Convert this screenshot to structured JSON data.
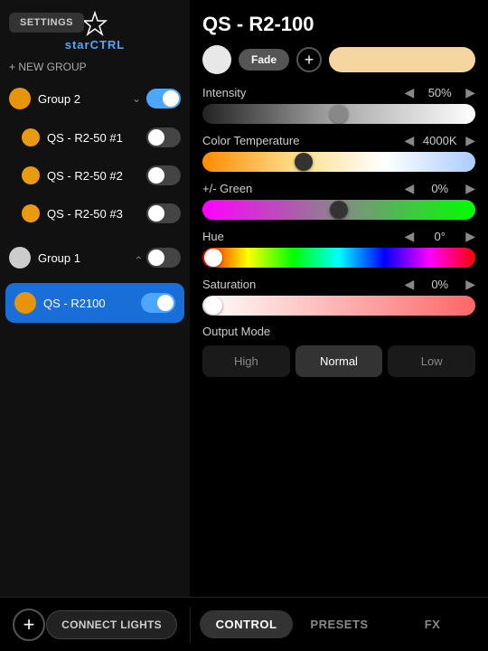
{
  "settings": {
    "button_label": "SETTINGS"
  },
  "logo": {
    "star": "✦",
    "text_prefix": "star",
    "text_suffix": "CTRL"
  },
  "left_panel": {
    "new_group_label": "+ NEW GROUP",
    "groups": [
      {
        "name": "Group 2",
        "color": "#e8940a",
        "expanded": true,
        "toggle": true,
        "children": [
          {
            "name": "QS - R2-50 #1",
            "color": "#e89a10",
            "toggle": false
          },
          {
            "name": "QS - R2-50 #2",
            "color": "#e89a10",
            "toggle": false
          },
          {
            "name": "QS - R2-50 #3",
            "color": "#e89a10",
            "toggle": false
          }
        ]
      },
      {
        "name": "Group 1",
        "color": "#ccc",
        "expanded": false,
        "toggle": false,
        "children": []
      },
      {
        "name": "QS - R2100",
        "color": "#e8940a",
        "expanded": false,
        "toggle": true,
        "selected": true,
        "children": []
      }
    ]
  },
  "right_panel": {
    "device_title": "QS - R2-100",
    "color_preview_bg": "#f5d5a0",
    "fade_label": "Fade",
    "sliders": {
      "intensity": {
        "label": "Intensity",
        "value": "50%",
        "thumb_pct": 50
      },
      "color_temp": {
        "label": "Color Temperature",
        "value": "4000K",
        "thumb_pct": 37
      },
      "green": {
        "label": "+/- Green",
        "value": "0%",
        "thumb_pct": 50
      },
      "hue": {
        "label": "Hue",
        "value": "0°",
        "thumb_pct": 0
      },
      "saturation": {
        "label": "Saturation",
        "value": "0%",
        "thumb_pct": 0
      }
    },
    "output_mode": {
      "label": "Output Mode",
      "buttons": [
        "High",
        "Normal",
        "Low"
      ],
      "active": "Normal"
    }
  },
  "bottom_bar": {
    "connect_lights_label": "CONNECT LIGHTS",
    "tabs": [
      {
        "label": "CONTROL",
        "active": true
      },
      {
        "label": "PRESETS",
        "active": false
      },
      {
        "label": "FX",
        "active": false
      }
    ],
    "add_icon": "+"
  }
}
